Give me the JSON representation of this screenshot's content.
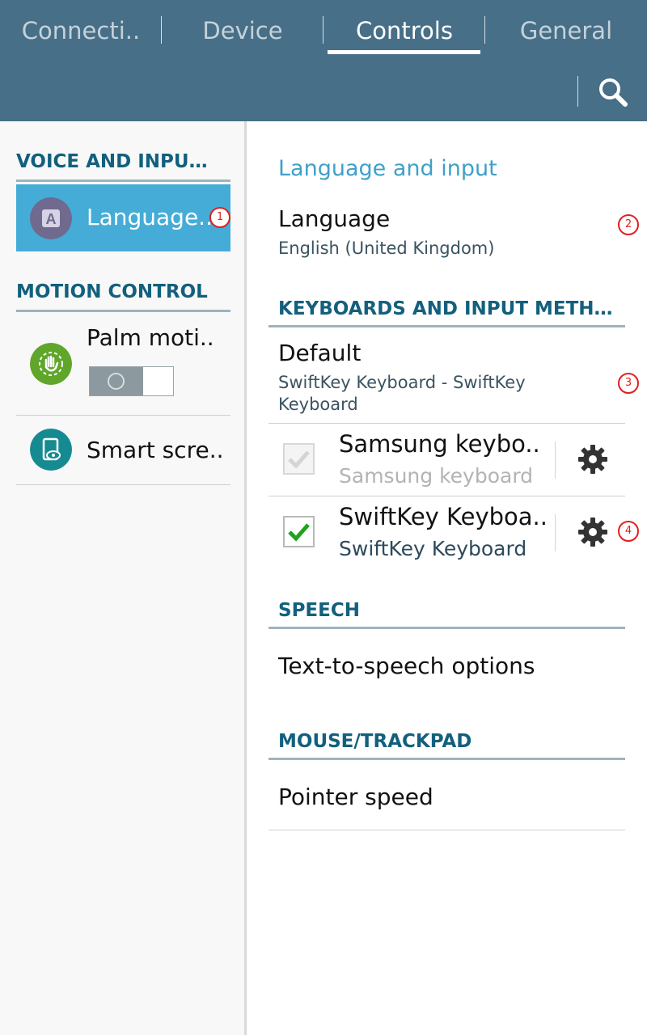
{
  "tabs": [
    {
      "label": "Connecti..",
      "active": false
    },
    {
      "label": "Device",
      "active": false
    },
    {
      "label": "Controls",
      "active": true
    },
    {
      "label": "General",
      "active": false
    }
  ],
  "search": {
    "icon": "search-icon"
  },
  "sidebar": {
    "sections": [
      {
        "header": "VOICE AND INPU…",
        "items": [
          {
            "label": "Language..",
            "icon": "language-icon",
            "selected": true
          }
        ]
      },
      {
        "header": "MOTION CONTROL",
        "items": [
          {
            "label": "Palm moti..",
            "icon": "palm-motion-icon",
            "toggle": false
          },
          {
            "label": "Smart scre..",
            "icon": "smart-screen-icon"
          }
        ]
      }
    ]
  },
  "main": {
    "title": "Language and input",
    "language": {
      "label": "Language",
      "value": "English (United Kingdom)"
    },
    "keyboards_header": "KEYBOARDS AND INPUT METH…",
    "default": {
      "label": "Default",
      "value": "SwiftKey Keyboard - SwiftKey Keyboard"
    },
    "keyboards": [
      {
        "name": "Samsung keybo..",
        "subtitle": "Samsung keyboard",
        "checked": true,
        "disabled": true
      },
      {
        "name": "SwiftKey Keyboa..",
        "subtitle": "SwiftKey Keyboard",
        "checked": true,
        "disabled": false
      }
    ],
    "speech_header": "SPEECH",
    "tts": "Text-to-speech options",
    "mouse_header": "MOUSE/TRACKPAD",
    "pointer_speed": "Pointer speed"
  },
  "badges": [
    "1",
    "2",
    "3",
    "4"
  ],
  "colors": {
    "header": "#476f87",
    "accent": "#44acd6",
    "section": "#12607d",
    "check": "#1fa31f"
  }
}
